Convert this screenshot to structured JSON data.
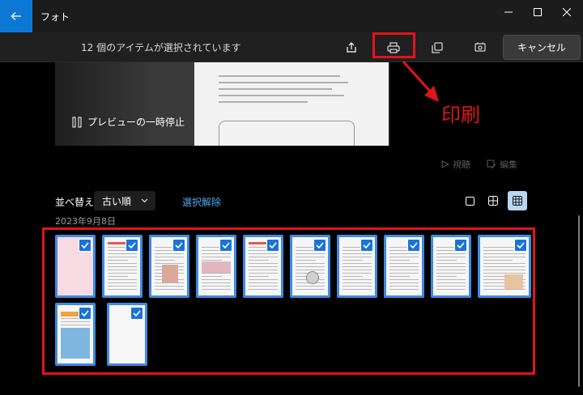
{
  "window": {
    "title": "フォト"
  },
  "toolbar": {
    "selection_text": "12 個のアイテムが選択されています",
    "cancel_label": "キャンセル"
  },
  "preview": {
    "pause_label": "プレビューの一時停止"
  },
  "annotation": {
    "label": "印刷",
    "color": "#e1141a"
  },
  "view_actions": {
    "view_label": "視聴",
    "edit_label": "編集"
  },
  "sort": {
    "label": "並べ替え:",
    "selected": "古い順"
  },
  "deselect_label": "選択解除",
  "date_group": "2023年9月8日",
  "thumbnails": [
    {
      "kind": "pink",
      "checked": true
    },
    {
      "kind": "doc-red",
      "checked": true
    },
    {
      "kind": "doc-pic",
      "checked": true
    },
    {
      "kind": "doc-figs",
      "checked": true
    },
    {
      "kind": "doc-red",
      "checked": true
    },
    {
      "kind": "doc-circle",
      "checked": true
    },
    {
      "kind": "doc-text",
      "checked": true
    },
    {
      "kind": "doc-text",
      "checked": true
    },
    {
      "kind": "doc-text",
      "checked": true
    },
    {
      "kind": "landscape",
      "checked": true
    },
    {
      "kind": "poster",
      "checked": true
    },
    {
      "kind": "blank",
      "checked": true
    }
  ],
  "colors": {
    "accent": "#0c78d4",
    "check": "#1a73d9",
    "border": "#3d8be2",
    "link": "#4ea6f4"
  }
}
